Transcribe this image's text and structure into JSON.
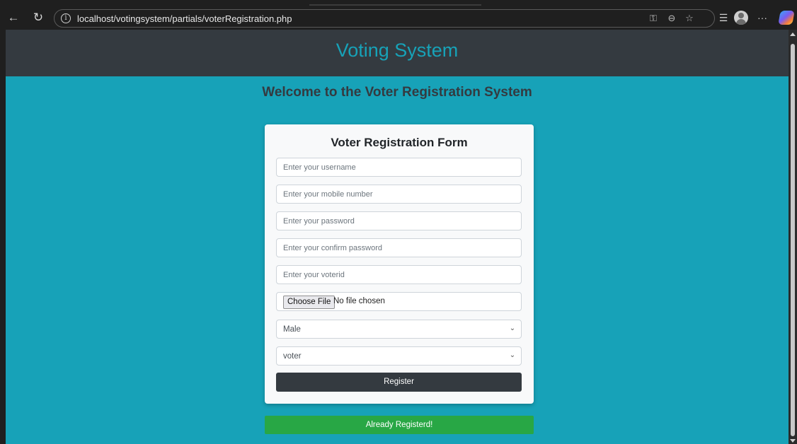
{
  "browser": {
    "url": "localhost/votingsystem/partials/voterRegistration.php",
    "icons": [
      "back-icon",
      "refresh-icon",
      "info-icon",
      "key-icon",
      "zoom-icon",
      "favorite-star-icon",
      "favorites-icon",
      "profile-avatar-icon",
      "more-icon",
      "copilot-icon"
    ]
  },
  "navbar": {
    "brand": "Voting System"
  },
  "page": {
    "welcome": "Welcome to the Voter Registration System"
  },
  "form": {
    "title": "Voter Registration Form",
    "username_placeholder": "Enter your username",
    "mobile_placeholder": "Enter your mobile number",
    "password_placeholder": "Enter your password",
    "confirm_password_placeholder": "Enter your  confirm password",
    "voterid_placeholder": "Enter your voterid",
    "file_button": "Choose File",
    "file_status": "No file chosen",
    "gender_selected": "Male",
    "role_selected": "voter",
    "register_label": "Register"
  },
  "already_registered_label": "Already Registerd!",
  "colors": {
    "page_bg": "#17a2b8",
    "navbar_bg": "#343a40",
    "brand_text": "#17a2b8",
    "register_bg": "#343a40",
    "already_bg": "#28a745"
  }
}
